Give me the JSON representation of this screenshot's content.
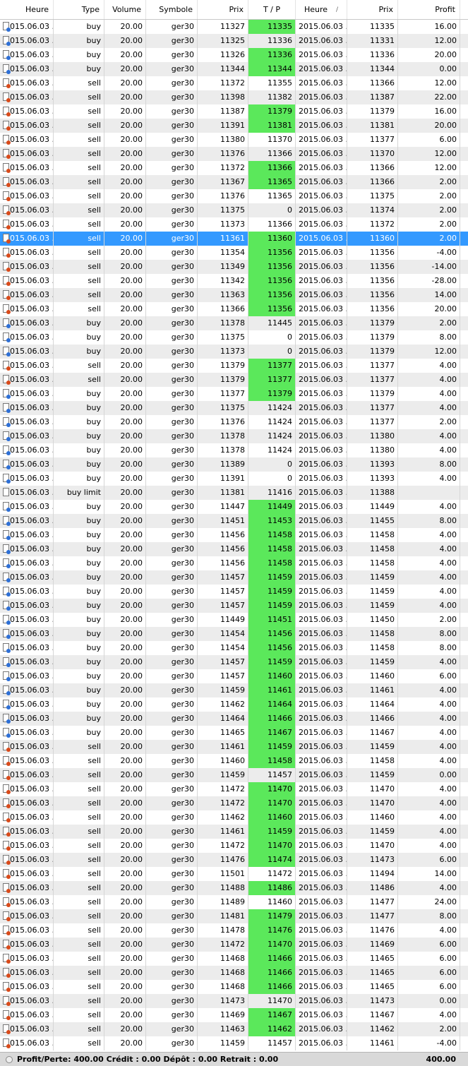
{
  "headers": [
    "Heure",
    "Type",
    "Volume",
    "Symbole",
    "Prix",
    "T / P",
    "Heure",
    "Prix",
    "Profit"
  ],
  "sort_indicator": "/",
  "selected_row": 15,
  "rows": [
    [
      "2015.06.03 ...",
      "buy",
      "20.00",
      "ger30",
      "11327",
      "11335",
      "2015.06.03 ...",
      "11335",
      "16.00",
      1
    ],
    [
      "2015.06.03 ...",
      "buy",
      "20.00",
      "ger30",
      "11325",
      "11336",
      "2015.06.03 ...",
      "11331",
      "12.00",
      0
    ],
    [
      "2015.06.03 ...",
      "buy",
      "20.00",
      "ger30",
      "11326",
      "11336",
      "2015.06.03 ...",
      "11336",
      "20.00",
      1
    ],
    [
      "2015.06.03 ...",
      "buy",
      "20.00",
      "ger30",
      "11344",
      "11344",
      "2015.06.03 ...",
      "11344",
      "0.00",
      1
    ],
    [
      "2015.06.03 ...",
      "sell",
      "20.00",
      "ger30",
      "11372",
      "11355",
      "2015.06.03 ...",
      "11366",
      "12.00",
      0
    ],
    [
      "2015.06.03 ...",
      "sell",
      "20.00",
      "ger30",
      "11398",
      "11382",
      "2015.06.03 ...",
      "11387",
      "22.00",
      0
    ],
    [
      "2015.06.03 ...",
      "sell",
      "20.00",
      "ger30",
      "11387",
      "11379",
      "2015.06.03 ...",
      "11379",
      "16.00",
      1
    ],
    [
      "2015.06.03 ...",
      "sell",
      "20.00",
      "ger30",
      "11391",
      "11381",
      "2015.06.03 ...",
      "11381",
      "20.00",
      1
    ],
    [
      "2015.06.03 ...",
      "sell",
      "20.00",
      "ger30",
      "11380",
      "11370",
      "2015.06.03 ...",
      "11377",
      "6.00",
      0
    ],
    [
      "2015.06.03 ...",
      "sell",
      "20.00",
      "ger30",
      "11376",
      "11366",
      "2015.06.03 ...",
      "11370",
      "12.00",
      0
    ],
    [
      "2015.06.03 ...",
      "sell",
      "20.00",
      "ger30",
      "11372",
      "11366",
      "2015.06.03 ...",
      "11366",
      "12.00",
      1
    ],
    [
      "2015.06.03 ...",
      "sell",
      "20.00",
      "ger30",
      "11367",
      "11365",
      "2015.06.03 ...",
      "11366",
      "2.00",
      1
    ],
    [
      "2015.06.03 ...",
      "sell",
      "20.00",
      "ger30",
      "11376",
      "11365",
      "2015.06.03 ...",
      "11375",
      "2.00",
      0
    ],
    [
      "2015.06.03 ...",
      "sell",
      "20.00",
      "ger30",
      "11375",
      "0",
      "2015.06.03 ...",
      "11374",
      "2.00",
      0
    ],
    [
      "2015.06.03 ...",
      "sell",
      "20.00",
      "ger30",
      "11373",
      "11366",
      "2015.06.03 ...",
      "11372",
      "2.00",
      0
    ],
    [
      "2015.06.03 ...",
      "sell",
      "20.00",
      "ger30",
      "11361",
      "11360",
      "2015.06.03 ...",
      "11360",
      "2.00",
      1
    ],
    [
      "2015.06.03 ...",
      "sell",
      "20.00",
      "ger30",
      "11354",
      "11356",
      "2015.06.03 ...",
      "11356",
      "-4.00",
      1
    ],
    [
      "2015.06.03 ...",
      "sell",
      "20.00",
      "ger30",
      "11349",
      "11356",
      "2015.06.03 ...",
      "11356",
      "-14.00",
      1
    ],
    [
      "2015.06.03 ...",
      "sell",
      "20.00",
      "ger30",
      "11342",
      "11356",
      "2015.06.03 ...",
      "11356",
      "-28.00",
      1
    ],
    [
      "2015.06.03 ...",
      "sell",
      "20.00",
      "ger30",
      "11363",
      "11356",
      "2015.06.03 ...",
      "11356",
      "14.00",
      1
    ],
    [
      "2015.06.03 ...",
      "sell",
      "20.00",
      "ger30",
      "11366",
      "11356",
      "2015.06.03 ...",
      "11356",
      "20.00",
      1
    ],
    [
      "2015.06.03 ...",
      "buy",
      "20.00",
      "ger30",
      "11378",
      "11445",
      "2015.06.03 ...",
      "11379",
      "2.00",
      0
    ],
    [
      "2015.06.03 ...",
      "buy",
      "20.00",
      "ger30",
      "11375",
      "0",
      "2015.06.03 ...",
      "11379",
      "8.00",
      0
    ],
    [
      "2015.06.03 ...",
      "buy",
      "20.00",
      "ger30",
      "11373",
      "0",
      "2015.06.03 ...",
      "11379",
      "12.00",
      0
    ],
    [
      "2015.06.03 ...",
      "sell",
      "20.00",
      "ger30",
      "11379",
      "11377",
      "2015.06.03 ...",
      "11377",
      "4.00",
      1
    ],
    [
      "2015.06.03 ...",
      "sell",
      "20.00",
      "ger30",
      "11379",
      "11377",
      "2015.06.03 ...",
      "11377",
      "4.00",
      1
    ],
    [
      "2015.06.03 ...",
      "buy",
      "20.00",
      "ger30",
      "11377",
      "11379",
      "2015.06.03 ...",
      "11379",
      "4.00",
      1
    ],
    [
      "2015.06.03 ...",
      "buy",
      "20.00",
      "ger30",
      "11375",
      "11424",
      "2015.06.03 ...",
      "11377",
      "4.00",
      0
    ],
    [
      "2015.06.03 ...",
      "buy",
      "20.00",
      "ger30",
      "11376",
      "11424",
      "2015.06.03 ...",
      "11377",
      "2.00",
      0
    ],
    [
      "2015.06.03 ...",
      "buy",
      "20.00",
      "ger30",
      "11378",
      "11424",
      "2015.06.03 ...",
      "11380",
      "4.00",
      0
    ],
    [
      "2015.06.03 ...",
      "buy",
      "20.00",
      "ger30",
      "11378",
      "11424",
      "2015.06.03 ...",
      "11380",
      "4.00",
      0
    ],
    [
      "2015.06.03 ...",
      "buy",
      "20.00",
      "ger30",
      "11389",
      "0",
      "2015.06.03 ...",
      "11393",
      "8.00",
      0
    ],
    [
      "2015.06.03 ...",
      "buy",
      "20.00",
      "ger30",
      "11391",
      "0",
      "2015.06.03 ...",
      "11393",
      "4.00",
      0
    ],
    [
      "2015.06.03 ...",
      "buy limit",
      "20.00",
      "ger30",
      "11381",
      "11416",
      "2015.06.03 ...",
      "11388",
      "",
      0
    ],
    [
      "2015.06.03 ...",
      "buy",
      "20.00",
      "ger30",
      "11447",
      "11449",
      "2015.06.03 ...",
      "11449",
      "4.00",
      1
    ],
    [
      "2015.06.03 ...",
      "buy",
      "20.00",
      "ger30",
      "11451",
      "11453",
      "2015.06.03 ...",
      "11455",
      "8.00",
      1
    ],
    [
      "2015.06.03 ...",
      "buy",
      "20.00",
      "ger30",
      "11456",
      "11458",
      "2015.06.03 ...",
      "11458",
      "4.00",
      1
    ],
    [
      "2015.06.03 ...",
      "buy",
      "20.00",
      "ger30",
      "11456",
      "11458",
      "2015.06.03 ...",
      "11458",
      "4.00",
      1
    ],
    [
      "2015.06.03 ...",
      "buy",
      "20.00",
      "ger30",
      "11456",
      "11458",
      "2015.06.03 ...",
      "11458",
      "4.00",
      1
    ],
    [
      "2015.06.03 ...",
      "buy",
      "20.00",
      "ger30",
      "11457",
      "11459",
      "2015.06.03 ...",
      "11459",
      "4.00",
      1
    ],
    [
      "2015.06.03 ...",
      "buy",
      "20.00",
      "ger30",
      "11457",
      "11459",
      "2015.06.03 ...",
      "11459",
      "4.00",
      1
    ],
    [
      "2015.06.03 ...",
      "buy",
      "20.00",
      "ger30",
      "11457",
      "11459",
      "2015.06.03 ...",
      "11459",
      "4.00",
      1
    ],
    [
      "2015.06.03 ...",
      "buy",
      "20.00",
      "ger30",
      "11449",
      "11451",
      "2015.06.03 ...",
      "11450",
      "2.00",
      1
    ],
    [
      "2015.06.03 ...",
      "buy",
      "20.00",
      "ger30",
      "11454",
      "11456",
      "2015.06.03 ...",
      "11458",
      "8.00",
      1
    ],
    [
      "2015.06.03 ...",
      "buy",
      "20.00",
      "ger30",
      "11454",
      "11456",
      "2015.06.03 ...",
      "11458",
      "8.00",
      1
    ],
    [
      "2015.06.03 ...",
      "buy",
      "20.00",
      "ger30",
      "11457",
      "11459",
      "2015.06.03 ...",
      "11459",
      "4.00",
      1
    ],
    [
      "2015.06.03 ...",
      "buy",
      "20.00",
      "ger30",
      "11457",
      "11460",
      "2015.06.03 ...",
      "11460",
      "6.00",
      1
    ],
    [
      "2015.06.03 ...",
      "buy",
      "20.00",
      "ger30",
      "11459",
      "11461",
      "2015.06.03 ...",
      "11461",
      "4.00",
      1
    ],
    [
      "2015.06.03 ...",
      "buy",
      "20.00",
      "ger30",
      "11462",
      "11464",
      "2015.06.03 ...",
      "11464",
      "4.00",
      1
    ],
    [
      "2015.06.03 ...",
      "buy",
      "20.00",
      "ger30",
      "11464",
      "11466",
      "2015.06.03 ...",
      "11466",
      "4.00",
      1
    ],
    [
      "2015.06.03 ...",
      "buy",
      "20.00",
      "ger30",
      "11465",
      "11467",
      "2015.06.03 ...",
      "11467",
      "4.00",
      1
    ],
    [
      "2015.06.03 ...",
      "sell",
      "20.00",
      "ger30",
      "11461",
      "11459",
      "2015.06.03 ...",
      "11459",
      "4.00",
      1
    ],
    [
      "2015.06.03 ...",
      "sell",
      "20.00",
      "ger30",
      "11460",
      "11458",
      "2015.06.03 ...",
      "11458",
      "4.00",
      1
    ],
    [
      "2015.06.03 ...",
      "sell",
      "20.00",
      "ger30",
      "11459",
      "11457",
      "2015.06.03 ...",
      "11459",
      "0.00",
      0
    ],
    [
      "2015.06.03 ...",
      "sell",
      "20.00",
      "ger30",
      "11472",
      "11470",
      "2015.06.03 ...",
      "11470",
      "4.00",
      1
    ],
    [
      "2015.06.03 ...",
      "sell",
      "20.00",
      "ger30",
      "11472",
      "11470",
      "2015.06.03 ...",
      "11470",
      "4.00",
      1
    ],
    [
      "2015.06.03 ...",
      "sell",
      "20.00",
      "ger30",
      "11462",
      "11460",
      "2015.06.03 ...",
      "11460",
      "4.00",
      1
    ],
    [
      "2015.06.03 ...",
      "sell",
      "20.00",
      "ger30",
      "11461",
      "11459",
      "2015.06.03 ...",
      "11459",
      "4.00",
      1
    ],
    [
      "2015.06.03 ...",
      "sell",
      "20.00",
      "ger30",
      "11472",
      "11470",
      "2015.06.03 ...",
      "11470",
      "4.00",
      1
    ],
    [
      "2015.06.03 ...",
      "sell",
      "20.00",
      "ger30",
      "11476",
      "11474",
      "2015.06.03 ...",
      "11473",
      "6.00",
      1
    ],
    [
      "2015.06.03 ...",
      "sell",
      "20.00",
      "ger30",
      "11501",
      "11472",
      "2015.06.03 ...",
      "11494",
      "14.00",
      0
    ],
    [
      "2015.06.03 ...",
      "sell",
      "20.00",
      "ger30",
      "11488",
      "11486",
      "2015.06.03 ...",
      "11486",
      "4.00",
      1
    ],
    [
      "2015.06.03 ...",
      "sell",
      "20.00",
      "ger30",
      "11489",
      "11460",
      "2015.06.03 ...",
      "11477",
      "24.00",
      0
    ],
    [
      "2015.06.03 ...",
      "sell",
      "20.00",
      "ger30",
      "11481",
      "11479",
      "2015.06.03 ...",
      "11477",
      "8.00",
      1
    ],
    [
      "2015.06.03 ...",
      "sell",
      "20.00",
      "ger30",
      "11478",
      "11476",
      "2015.06.03 ...",
      "11476",
      "4.00",
      1
    ],
    [
      "2015.06.03 ...",
      "sell",
      "20.00",
      "ger30",
      "11472",
      "11470",
      "2015.06.03 ...",
      "11469",
      "6.00",
      1
    ],
    [
      "2015.06.03 ...",
      "sell",
      "20.00",
      "ger30",
      "11468",
      "11466",
      "2015.06.03 ...",
      "11465",
      "6.00",
      1
    ],
    [
      "2015.06.03 ...",
      "sell",
      "20.00",
      "ger30",
      "11468",
      "11466",
      "2015.06.03 ...",
      "11465",
      "6.00",
      1
    ],
    [
      "2015.06.03 ...",
      "sell",
      "20.00",
      "ger30",
      "11468",
      "11466",
      "2015.06.03 ...",
      "11465",
      "6.00",
      1
    ],
    [
      "2015.06.03 ...",
      "sell",
      "20.00",
      "ger30",
      "11473",
      "11470",
      "2015.06.03 ...",
      "11473",
      "0.00",
      0
    ],
    [
      "2015.06.03 ...",
      "sell",
      "20.00",
      "ger30",
      "11469",
      "11467",
      "2015.06.03 ...",
      "11467",
      "4.00",
      1
    ],
    [
      "2015.06.03 ...",
      "sell",
      "20.00",
      "ger30",
      "11463",
      "11462",
      "2015.06.03 ...",
      "11462",
      "2.00",
      1
    ],
    [
      "2015.06.03 ...",
      "sell",
      "20.00",
      "ger30",
      "11459",
      "11457",
      "2015.06.03 ...",
      "11461",
      "-4.00",
      0
    ]
  ],
  "footer": {
    "summary": "Profit/Perte: 400.00  Crédit : 0.00  Dépôt : 0.00  Retrait : 0.00",
    "total": "400.00"
  },
  "colors": {
    "tp_highlight": "#5be85b",
    "selection": "#3399ff",
    "buy_marker": "#2d6fd6",
    "sell_marker": "#d94a1a"
  },
  "icons": {
    "row": "order-document-icon",
    "footer": "balance-icon"
  }
}
